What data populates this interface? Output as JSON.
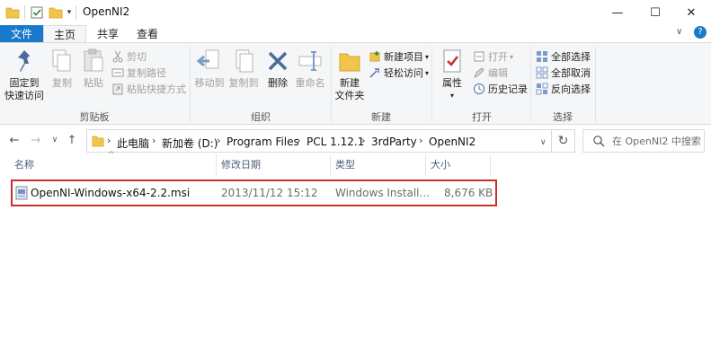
{
  "window": {
    "title": "OpenNI2",
    "qa_dropdown": "▾",
    "minimize": "—",
    "maximize": "☐",
    "close": "✕"
  },
  "tabs": {
    "file": "文件",
    "home": "主页",
    "share": "共享",
    "view": "查看",
    "help": "?"
  },
  "ribbon": {
    "clipboard": {
      "label": "剪贴板",
      "pin": "固定到\n快速访问",
      "pin_line1": "固定到",
      "pin_line2": "快速访问",
      "copy": "复制",
      "paste": "粘贴",
      "cut": "剪切",
      "copy_path": "复制路径",
      "paste_shortcut": "粘贴快捷方式"
    },
    "organize": {
      "label": "组织",
      "move_to": "移动到",
      "copy_to": "复制到",
      "delete": "删除",
      "rename": "重命名"
    },
    "new": {
      "label": "新建",
      "new_folder_line1": "新建",
      "new_folder_line2": "文件夹",
      "new_item": "新建项目",
      "easy_access": "轻松访问"
    },
    "open": {
      "label": "打开",
      "properties": "属性",
      "open": "打开",
      "edit": "编辑",
      "history": "历史记录"
    },
    "select": {
      "label": "选择",
      "select_all": "全部选择",
      "select_none": "全部取消",
      "invert": "反向选择"
    }
  },
  "address": {
    "crumbs": [
      "此电脑",
      "新加卷 (D:)",
      "Program Files",
      "PCL 1.12.1",
      "3rdParty",
      "OpenNI2"
    ],
    "search_placeholder": "在 OpenNI2 中搜索"
  },
  "columns": {
    "name": "名称",
    "date": "修改日期",
    "type": "类型",
    "size": "大小"
  },
  "files": [
    {
      "name": "OpenNI-Windows-x64-2.2.msi",
      "date": "2013/11/12 15:12",
      "type": "Windows Install...",
      "size": "8,676 KB"
    }
  ],
  "colors": {
    "accent": "#1979ca",
    "highlight_border": "#c9302c",
    "folder": "#f0c54a"
  }
}
